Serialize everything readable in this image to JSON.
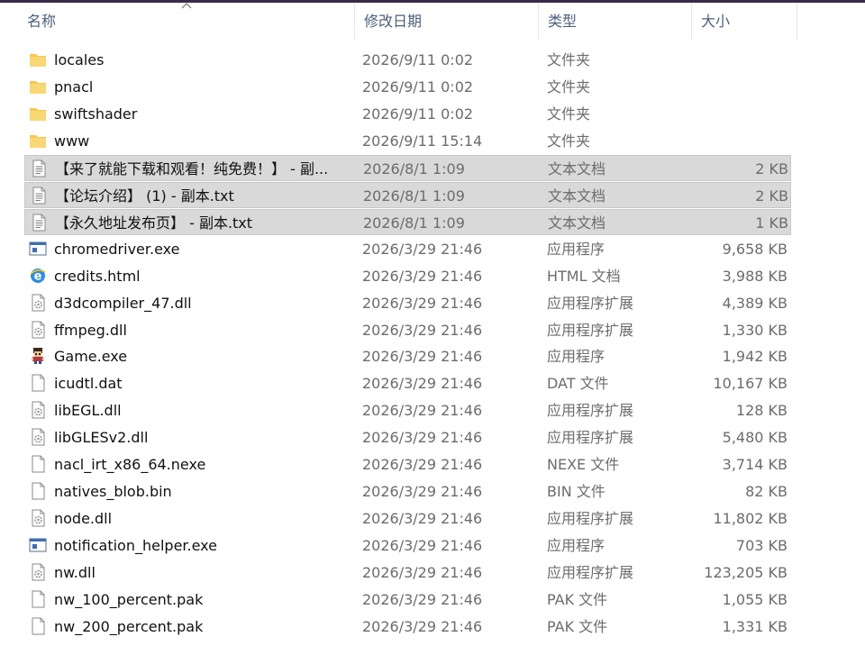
{
  "columns": {
    "name": "名称",
    "date": "修改日期",
    "type": "类型",
    "size": "大小"
  },
  "files": [
    {
      "name": "locales",
      "date": "2026/9/11 0:02",
      "type": "文件夹",
      "size": "",
      "icon": "folder-icon",
      "selected": false
    },
    {
      "name": "pnacl",
      "date": "2026/9/11 0:02",
      "type": "文件夹",
      "size": "",
      "icon": "folder-icon",
      "selected": false
    },
    {
      "name": "swiftshader",
      "date": "2026/9/11 0:02",
      "type": "文件夹",
      "size": "",
      "icon": "folder-icon",
      "selected": false
    },
    {
      "name": "www",
      "date": "2026/9/11 15:14",
      "type": "文件夹",
      "size": "",
      "icon": "folder-icon",
      "selected": false
    },
    {
      "name": "【来了就能下载和观看！纯免费！】 - 副...",
      "date": "2026/8/1 1:09",
      "type": "文本文档",
      "size": "2 KB",
      "icon": "text-file-icon",
      "selected": true
    },
    {
      "name": "【论坛介绍】 (1) - 副本.txt",
      "date": "2026/8/1 1:09",
      "type": "文本文档",
      "size": "2 KB",
      "icon": "text-file-icon",
      "selected": true
    },
    {
      "name": "【永久地址发布页】 - 副本.txt",
      "date": "2026/8/1 1:09",
      "type": "文本文档",
      "size": "1 KB",
      "icon": "text-file-icon",
      "selected": true
    },
    {
      "name": "chromedriver.exe",
      "date": "2026/3/29 21:46",
      "type": "应用程序",
      "size": "9,658 KB",
      "icon": "app-window-icon",
      "selected": false
    },
    {
      "name": "credits.html",
      "date": "2026/3/29 21:46",
      "type": "HTML 文档",
      "size": "3,988 KB",
      "icon": "browser-e-icon",
      "selected": false
    },
    {
      "name": "d3dcompiler_47.dll",
      "date": "2026/3/29 21:46",
      "type": "应用程序扩展",
      "size": "4,389 KB",
      "icon": "dll-file-icon",
      "selected": false
    },
    {
      "name": "ffmpeg.dll",
      "date": "2026/3/29 21:46",
      "type": "应用程序扩展",
      "size": "1,330 KB",
      "icon": "dll-file-icon",
      "selected": false
    },
    {
      "name": "Game.exe",
      "date": "2026/3/29 21:46",
      "type": "应用程序",
      "size": "1,942 KB",
      "icon": "game-app-icon",
      "selected": false
    },
    {
      "name": "icudtl.dat",
      "date": "2026/3/29 21:46",
      "type": "DAT 文件",
      "size": "10,167 KB",
      "icon": "blank-file-icon",
      "selected": false
    },
    {
      "name": "libEGL.dll",
      "date": "2026/3/29 21:46",
      "type": "应用程序扩展",
      "size": "128 KB",
      "icon": "dll-file-icon",
      "selected": false
    },
    {
      "name": "libGLESv2.dll",
      "date": "2026/3/29 21:46",
      "type": "应用程序扩展",
      "size": "5,480 KB",
      "icon": "dll-file-icon",
      "selected": false
    },
    {
      "name": "nacl_irt_x86_64.nexe",
      "date": "2026/3/29 21:46",
      "type": "NEXE 文件",
      "size": "3,714 KB",
      "icon": "blank-file-icon",
      "selected": false
    },
    {
      "name": "natives_blob.bin",
      "date": "2026/3/29 21:46",
      "type": "BIN 文件",
      "size": "82 KB",
      "icon": "blank-file-icon",
      "selected": false
    },
    {
      "name": "node.dll",
      "date": "2026/3/29 21:46",
      "type": "应用程序扩展",
      "size": "11,802 KB",
      "icon": "dll-file-icon",
      "selected": false
    },
    {
      "name": "notification_helper.exe",
      "date": "2026/3/29 21:46",
      "type": "应用程序",
      "size": "703 KB",
      "icon": "app-window-icon",
      "selected": false
    },
    {
      "name": "nw.dll",
      "date": "2026/3/29 21:46",
      "type": "应用程序扩展",
      "size": "123,205 KB",
      "icon": "dll-file-icon",
      "selected": false
    },
    {
      "name": "nw_100_percent.pak",
      "date": "2026/3/29 21:46",
      "type": "PAK 文件",
      "size": "1,055 KB",
      "icon": "blank-file-icon",
      "selected": false
    },
    {
      "name": "nw_200_percent.pak",
      "date": "2026/3/29 21:46",
      "type": "PAK 文件",
      "size": "1,331 KB",
      "icon": "blank-file-icon",
      "selected": false
    }
  ]
}
